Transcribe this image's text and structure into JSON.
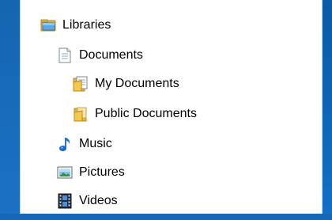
{
  "tree": {
    "root": {
      "label": "Libraries",
      "icon": "libraries-icon"
    },
    "items": [
      {
        "label": "Documents",
        "icon": "documents-icon",
        "level": 1
      },
      {
        "label": "My Documents",
        "icon": "folder-documents-icon",
        "level": 2
      },
      {
        "label": "Public Documents",
        "icon": "folder-icon",
        "level": 2
      },
      {
        "label": "Music",
        "icon": "music-note-icon",
        "level": 1
      },
      {
        "label": "Pictures",
        "icon": "pictures-icon",
        "level": 1
      },
      {
        "label": "Videos",
        "icon": "film-strip-icon",
        "level": 1
      }
    ]
  },
  "colors": {
    "desktop_blue": "#1467b4",
    "panel_background": "#ffffff",
    "text": "#000000"
  }
}
